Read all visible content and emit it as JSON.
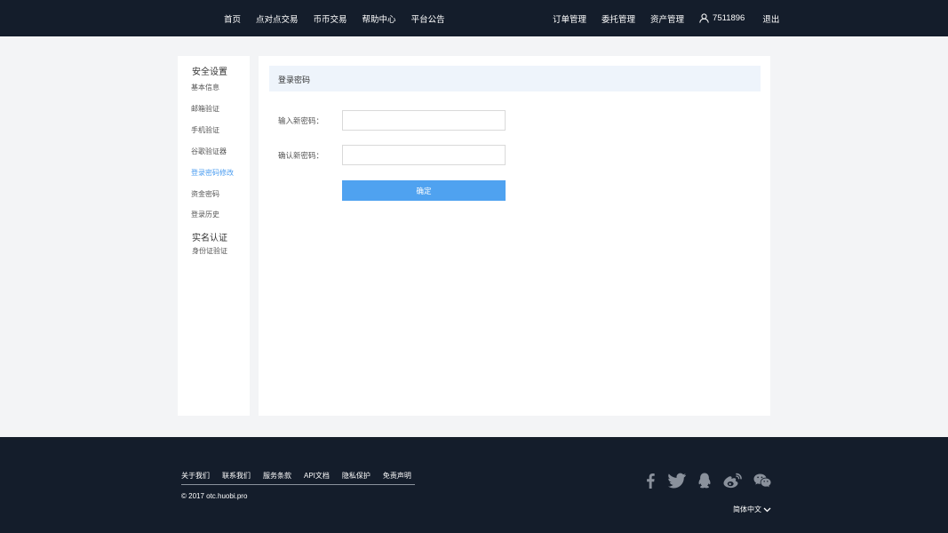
{
  "header": {
    "nav_left": [
      "首页",
      "点对点交易",
      "币币交易",
      "帮助中心",
      "平台公告"
    ],
    "nav_right": [
      "订单管理",
      "委托管理",
      "资产管理"
    ],
    "user_id": "7511896",
    "logout": "退出"
  },
  "sidebar": {
    "group1_title": "安全设置",
    "group1_items": [
      "基本信息",
      "邮箱验证",
      "手机验证",
      "谷歌验证器",
      "登录密码修改",
      "资金密码",
      "登录历史"
    ],
    "group2_title": "实名认证",
    "group2_items": [
      "身份证验证"
    ],
    "active_item": "登录密码修改"
  },
  "main": {
    "panel_title": "登录密码",
    "new_password_label": "输入新密码：",
    "confirm_password_label": "确认新密码：",
    "submit_label": "确定"
  },
  "footer": {
    "links": [
      "关于我们",
      "联系我们",
      "服务条款",
      "API文档",
      "隐私保护",
      "免责声明"
    ],
    "copyright": "© 2017 otc.huobi.pro",
    "language": "简体中文",
    "social_icons": [
      "facebook-icon",
      "twitter-icon",
      "qq-icon",
      "weibo-icon",
      "wechat-icon"
    ]
  },
  "colors": {
    "topbar_bg": "#141d2b",
    "accent": "#4fa2f0",
    "active_link": "#4a9cf0",
    "panel_head_bg": "#eef4fb"
  }
}
